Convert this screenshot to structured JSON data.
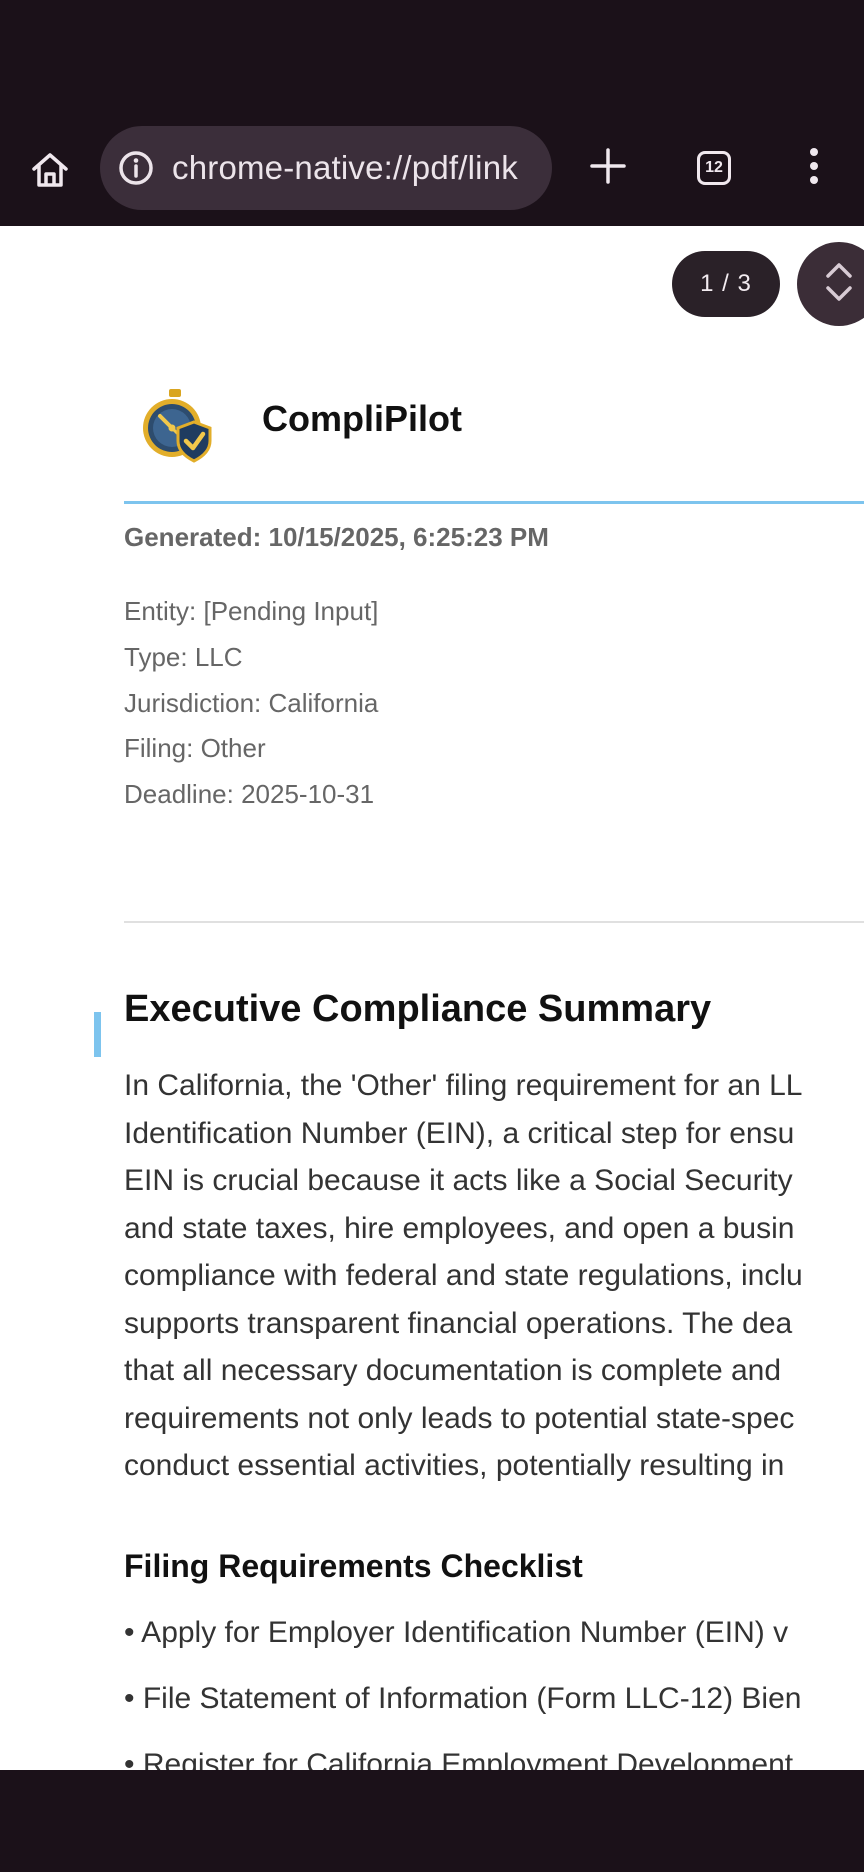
{
  "browser": {
    "url": "chrome-native://pdf/link",
    "tab_count": "12",
    "icons": {
      "home": "home-icon",
      "info": "info-icon",
      "new_tab": "plus-icon",
      "tabs": "tab-switcher-icon",
      "menu": "more-vert-icon"
    }
  },
  "pdf_viewer": {
    "page_indicator": "1 / 3",
    "scroll_handle_icon": "chevron-up-down-icon"
  },
  "document": {
    "brand": "CompliPilot",
    "generated": "Generated: 10/15/2025, 6:25:23 PM",
    "meta": [
      "Entity: [Pending Input]",
      "Type: LLC",
      "Jurisdiction: California",
      "Filing: Other",
      "Deadline: 2025-10-31"
    ],
    "summary_title": "Executive Compliance Summary",
    "summary_lines": [
      "In California, the 'Other' filing requirement for an LL",
      "Identification Number (EIN), a critical step for ensu",
      "EIN is crucial because it acts like a Social Security",
      "and state taxes, hire employees, and open a busin",
      "compliance with federal and state regulations, inclu",
      "supports transparent financial operations. The dea",
      "that all necessary documentation is complete and",
      "requirements not only leads to potential state-spec",
      "conduct essential activities, potentially resulting in"
    ],
    "checklist_title": "Filing Requirements Checklist",
    "checklist": [
      "• Apply for Employer Identification Number (EIN) v",
      "• File Statement of Information (Form LLC-12) Bien",
      "• Register for California Employment Development"
    ]
  },
  "colors": {
    "chrome_bg": "#1b1119",
    "omnibox_bg": "#3b2e3a",
    "accent_rule": "#7dc4ee"
  }
}
